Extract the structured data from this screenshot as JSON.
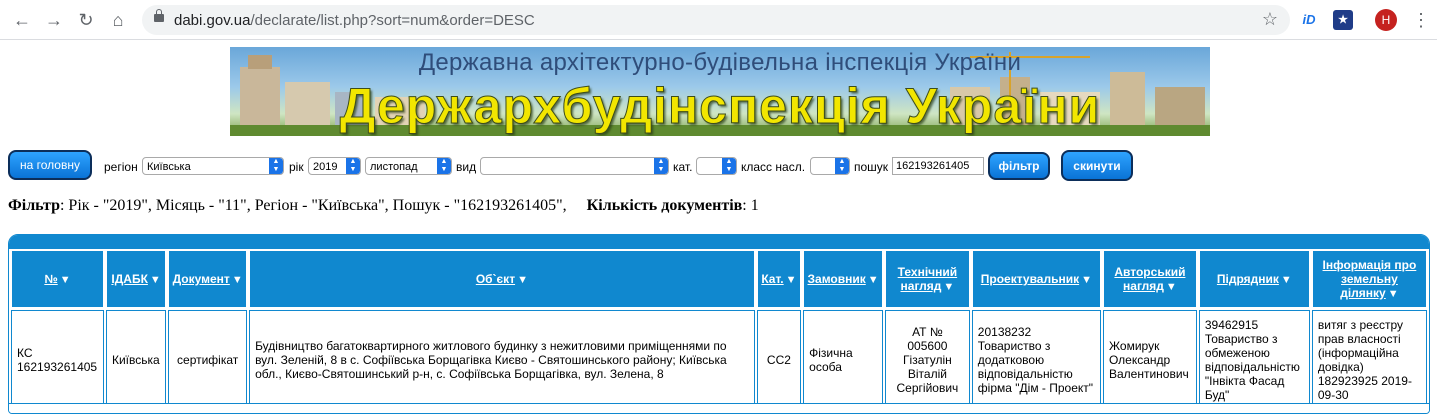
{
  "browser": {
    "url_host": "dabi.gov.ua",
    "url_path": "/declarate/list.php?sort=num&order=DESC",
    "avatar_letter": "H"
  },
  "banner": {
    "subtitle": "Державна архітектурно-будівельна інспекція України",
    "title": "Держархбудінспекція України"
  },
  "filter_bar": {
    "home_button": "на головну",
    "region_label": "регіон",
    "region_value": "Київська",
    "year_label": "рік",
    "year_value": "2019",
    "month_value": "листопад",
    "type_label": "вид",
    "type_value": "",
    "category_label": "кат.",
    "category_value": "",
    "class_label": "класс насл.",
    "class_value": "",
    "search_label": "пошук",
    "search_value": "162193261405",
    "filter_button": "фільтр",
    "reset_button": "скинути"
  },
  "filter_summary": {
    "filter_label": "Фільтр",
    "filter_text": ": Рік - \"2019\", Місяць - \"11\", Регіон - \"Київська\", Пошук - \"162193261405\",",
    "count_label": "Кількість документів",
    "count_value": ": 1"
  },
  "table": {
    "sort_glyph": "▼",
    "headers": [
      "№",
      "ІДАБК",
      "Документ",
      "Об`єкт",
      "Кат.",
      "Замовник",
      "Технічний нагляд",
      "Проектувальник",
      "Авторський нагляд",
      "Підрядник",
      "Інформація про земельну ділянку"
    ],
    "rows": [
      [
        "КС 162193261405",
        "Київська",
        "сертифікат",
        "Будівництво багатоквартирного житлового будинку з нежитловими приміщеннями по вул. Зеленій, 8 в с. Софіївська Борщагівка Києво - Святошинського району; Київська обл., Києво-Святошинський р-н, с. Софіївська Борщагівка, вул. Зелена, 8",
        "СС2",
        "Фізична особа",
        "АТ № 005600 Гізатулін Віталій Сергійович",
        "20138232 Товариство з додатковою відповідальністю фірма \"Дім - Проект\"",
        "Жомирук Олександр Валентинович",
        "39462915 Товариство з обмеженою відповідальністю \"Інвікта Фасад Буд\"",
        "витяг з реєстру прав власності (інформаційна довідка) 182923925 2019-09-30"
      ]
    ]
  }
}
